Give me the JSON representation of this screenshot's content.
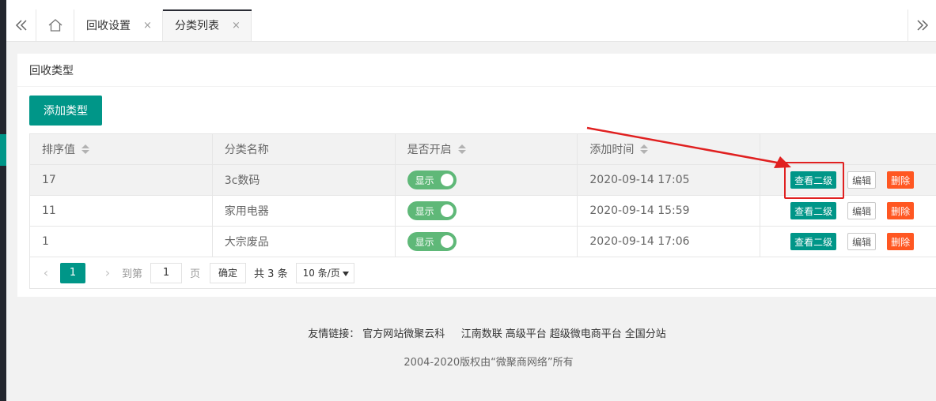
{
  "tabs": [
    {
      "label": "回收设置",
      "close": "×"
    },
    {
      "label": "分类列表",
      "close": "×"
    }
  ],
  "card": {
    "title": "回收类型",
    "add_button": "添加类型"
  },
  "table": {
    "headers": [
      "排序值",
      "分类名称",
      "是否开启",
      "添加时间",
      ""
    ],
    "rows": [
      {
        "sort": "17",
        "name": "3c数码",
        "status": "显示",
        "time": "2020-09-14 17:05"
      },
      {
        "sort": "11",
        "name": "家用电器",
        "status": "显示",
        "time": "2020-09-14 15:59"
      },
      {
        "sort": "1",
        "name": "大宗废品",
        "status": "显示",
        "time": "2020-09-14 17:06"
      }
    ],
    "actions": {
      "view": "查看二级",
      "edit": "编辑",
      "delete": "删除"
    }
  },
  "pager": {
    "current": "1",
    "goto_prefix": "到第",
    "goto_value": "1",
    "goto_suffix": "页",
    "confirm": "确定",
    "total": "共 3 条",
    "page_size": "10 条/页"
  },
  "footer": {
    "links_label": "友情链接：",
    "links": [
      "官方网站微聚云科",
      "江南数联",
      "高级平台",
      "超级微电商平台",
      "全国分站"
    ],
    "copyright": "2004-2020版权由“微聚商网络”所有"
  },
  "colors": {
    "accent": "#009688",
    "switch_on": "#5fb878",
    "danger": "#ff5722",
    "annotation": "#e02020"
  },
  "icons": [
    "double-chevron-left-icon",
    "home-icon",
    "double-chevron-right-icon",
    "sort-icon",
    "chevron-left-icon",
    "chevron-right-icon",
    "caret-down-icon"
  ]
}
